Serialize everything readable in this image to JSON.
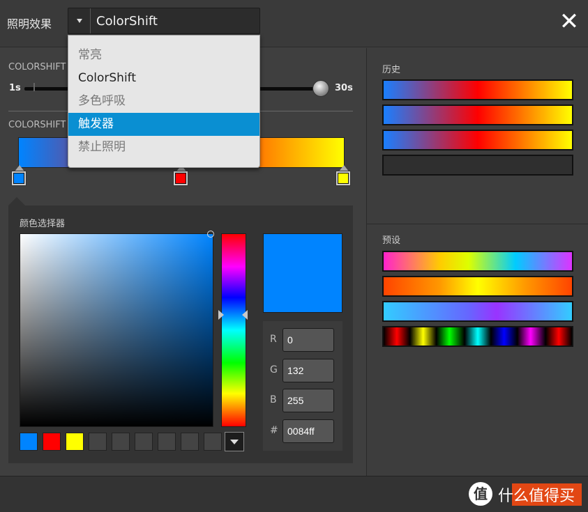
{
  "header": {
    "effect_label": "照明效果",
    "effect_value": "ColorShift",
    "close_symbol": "✕"
  },
  "dropdown": {
    "items": [
      {
        "label": "常亮",
        "state": "normal"
      },
      {
        "label": "ColorShift",
        "state": "selected"
      },
      {
        "label": "多色呼吸",
        "state": "normal"
      },
      {
        "label": "触发器",
        "state": "highlighted"
      },
      {
        "label": "禁止照明",
        "state": "normal"
      }
    ]
  },
  "speed": {
    "label": "COLORSHIFT",
    "min_label": "1s",
    "max_label": "30s",
    "value": 30
  },
  "gradient": {
    "label": "COLORSHIFT",
    "stops": [
      {
        "color": "#0084ff"
      },
      {
        "color": "#ff0000"
      },
      {
        "color": "#ffff00"
      }
    ]
  },
  "picker": {
    "title": "颜色选择器",
    "current_color": "#0084ff",
    "fields": [
      {
        "label": "R",
        "value": "0"
      },
      {
        "label": "G",
        "value": "132"
      },
      {
        "label": "B",
        "value": "255"
      },
      {
        "label": "#",
        "value": "0084ff"
      }
    ],
    "saved_swatches": [
      "#0084ff",
      "#ff0000",
      "#ffff00",
      "#444444",
      "#444444",
      "#444444",
      "#444444",
      "#444444",
      "#444444"
    ]
  },
  "history": {
    "label": "历史",
    "items": [
      "linear-gradient(to right, #1a7fff 0%, #ff0000 50%, #ffff00 100%)",
      "linear-gradient(to right, #1a7fff 0%, #ff0000 50%, #ffff00 100%)",
      "linear-gradient(to right, #1a7fff 0%, #ff0000 50%, #ffff00 100%)",
      "linear-gradient(to right, #2f2f2f, #2f2f2f)"
    ]
  },
  "presets": {
    "label": "预设",
    "items": [
      "linear-gradient(to right, #ff22cc 0%, #ffcc00 30%, #ddff00 45%, #00ccff 70%, #dd33ff 100%)",
      "linear-gradient(to right, #ff4400 0%, #ff9900 30%, #ffff00 50%, #ff9900 75%, #ff4400 100%)",
      "linear-gradient(to right, #33ccff 0%, #6666ff 45%, #9933ff 60%, #33ccff 100%)",
      "linear-gradient(to right, #000 0%, #ff0000 7%, #000 14%, #ffff00 21%, #000 28%, #00ff00 35%, #000 43%, #00ffff 50%, #000 57%, #0000ff 64%, #000 71%, #ff00ff 78%, #000 86%, #ff0000 93%, #000 100%)"
    ]
  },
  "watermark": {
    "logo_char": "值",
    "text": "什么值得买"
  }
}
